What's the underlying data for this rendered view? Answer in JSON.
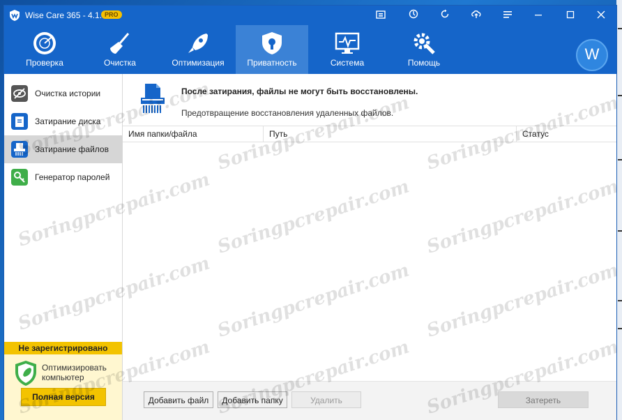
{
  "window": {
    "title": "Wise Care 365 - 4.1.8",
    "badge": "PRO"
  },
  "title_controls": [
    "screenshot-icon",
    "update-icon",
    "refresh-icon",
    "upload-icon",
    "settings-list-icon",
    "minimize-icon",
    "maximize-icon",
    "close-icon"
  ],
  "toolbar": {
    "items": [
      {
        "label": "Проверка",
        "icon": "radar-icon"
      },
      {
        "label": "Очистка",
        "icon": "broom-icon"
      },
      {
        "label": "Оптимизация",
        "icon": "rocket-icon"
      },
      {
        "label": "Приватность",
        "icon": "shield-lock-icon",
        "active": true
      },
      {
        "label": "Система",
        "icon": "monitor-pulse-icon"
      },
      {
        "label": "Помощь",
        "icon": "gear-wrench-icon"
      }
    ],
    "avatar_letter": "W"
  },
  "sidebar": {
    "items": [
      {
        "label": "Очистка истории",
        "icon": "eye-off-icon",
        "color": "#555555"
      },
      {
        "label": "Затирание диска",
        "icon": "disk-wipe-icon",
        "color": "#1565c9"
      },
      {
        "label": "Затирание файлов",
        "icon": "file-shredder-icon",
        "color": "#1565c9",
        "active": true
      },
      {
        "label": "Генератор паролей",
        "icon": "key-icon",
        "color": "#3fae49"
      }
    ],
    "unregistered": "Не зарегистрировано",
    "promo_text": "Оптимизировать компьютер",
    "full_version_button": "Полная версия"
  },
  "main": {
    "header_title": "После затирания, файлы не могут быть восстановлены.",
    "header_subtitle": "Предотвращение восстановления удаленных файлов.",
    "columns": [
      "Имя папки/файла",
      "Путь",
      "Статус"
    ],
    "rows": []
  },
  "footer": {
    "add_file": "Добавить файл",
    "add_folder": "Добавить папку",
    "delete": "Удалить",
    "wipe": "Затереть"
  },
  "watermark": "Soringpcrepair.com",
  "colors": {
    "accent": "#1565c9",
    "active_tab": "#3b82d6",
    "unregistered": "#f3c300"
  }
}
